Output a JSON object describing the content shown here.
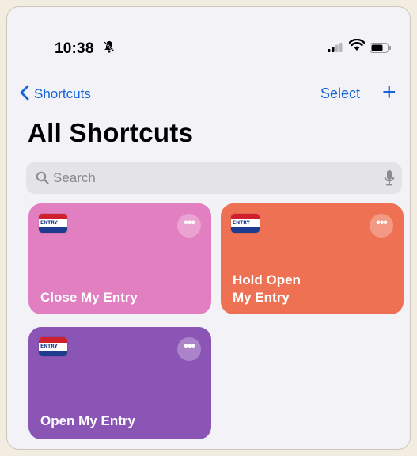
{
  "status": {
    "time": "10:38"
  },
  "nav": {
    "back_label": "Shortcuts",
    "select_label": "Select",
    "add_label": "+"
  },
  "page": {
    "title": "All Shortcuts"
  },
  "search": {
    "placeholder": "Search"
  },
  "shortcuts": [
    {
      "label": "Close My Entry",
      "color": "#e27fc0",
      "more": "•••"
    },
    {
      "label": "Hold Open\nMy Entry",
      "color": "#ef7153",
      "more": "•••"
    },
    {
      "label": "Open My Entry",
      "color": "#8b55b5",
      "more": "•••"
    }
  ],
  "icons": [
    "bell-slash-icon",
    "cellular-signal-icon",
    "wifi-icon",
    "battery-icon",
    "chevron-left-icon",
    "plus-icon",
    "search-icon",
    "microphone-icon",
    "more-icon",
    "app-icon"
  ]
}
